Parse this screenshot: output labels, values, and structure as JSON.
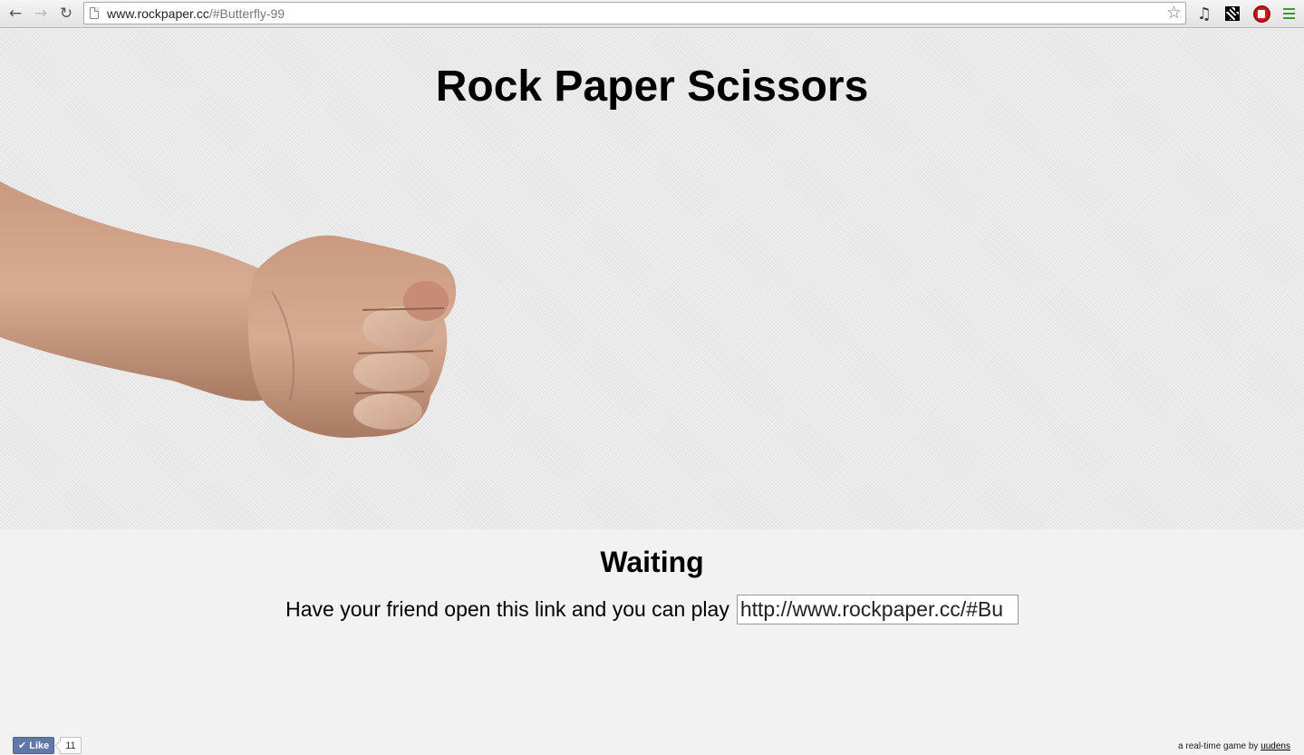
{
  "browser": {
    "url_host": "www.rockpaper.cc",
    "url_path": "/#Butterfly-99"
  },
  "page": {
    "title": "Rock Paper Scissors",
    "player_choice": "rock",
    "status_heading": "Waiting",
    "invite_text": "Have your friend open this link and you can play",
    "share_link_value": "http://www.rockpaper.cc/#Bu"
  },
  "footer": {
    "like_label": "Like",
    "like_count": "11",
    "credit_text": "a real-time game by",
    "credit_link": "uudens"
  },
  "icons": {
    "back": "arrow-left-icon",
    "forward": "arrow-right-icon",
    "reload": "reload-icon",
    "bookmark": "star-icon",
    "music": "music-note-icon",
    "qr": "qr-code-icon",
    "adblock": "stop-hand-icon",
    "menu": "menu-icon"
  },
  "colors": {
    "menu_icon": "#3a9a2a",
    "adblock_icon": "#d8141c",
    "like_button": "#5f78ab"
  }
}
